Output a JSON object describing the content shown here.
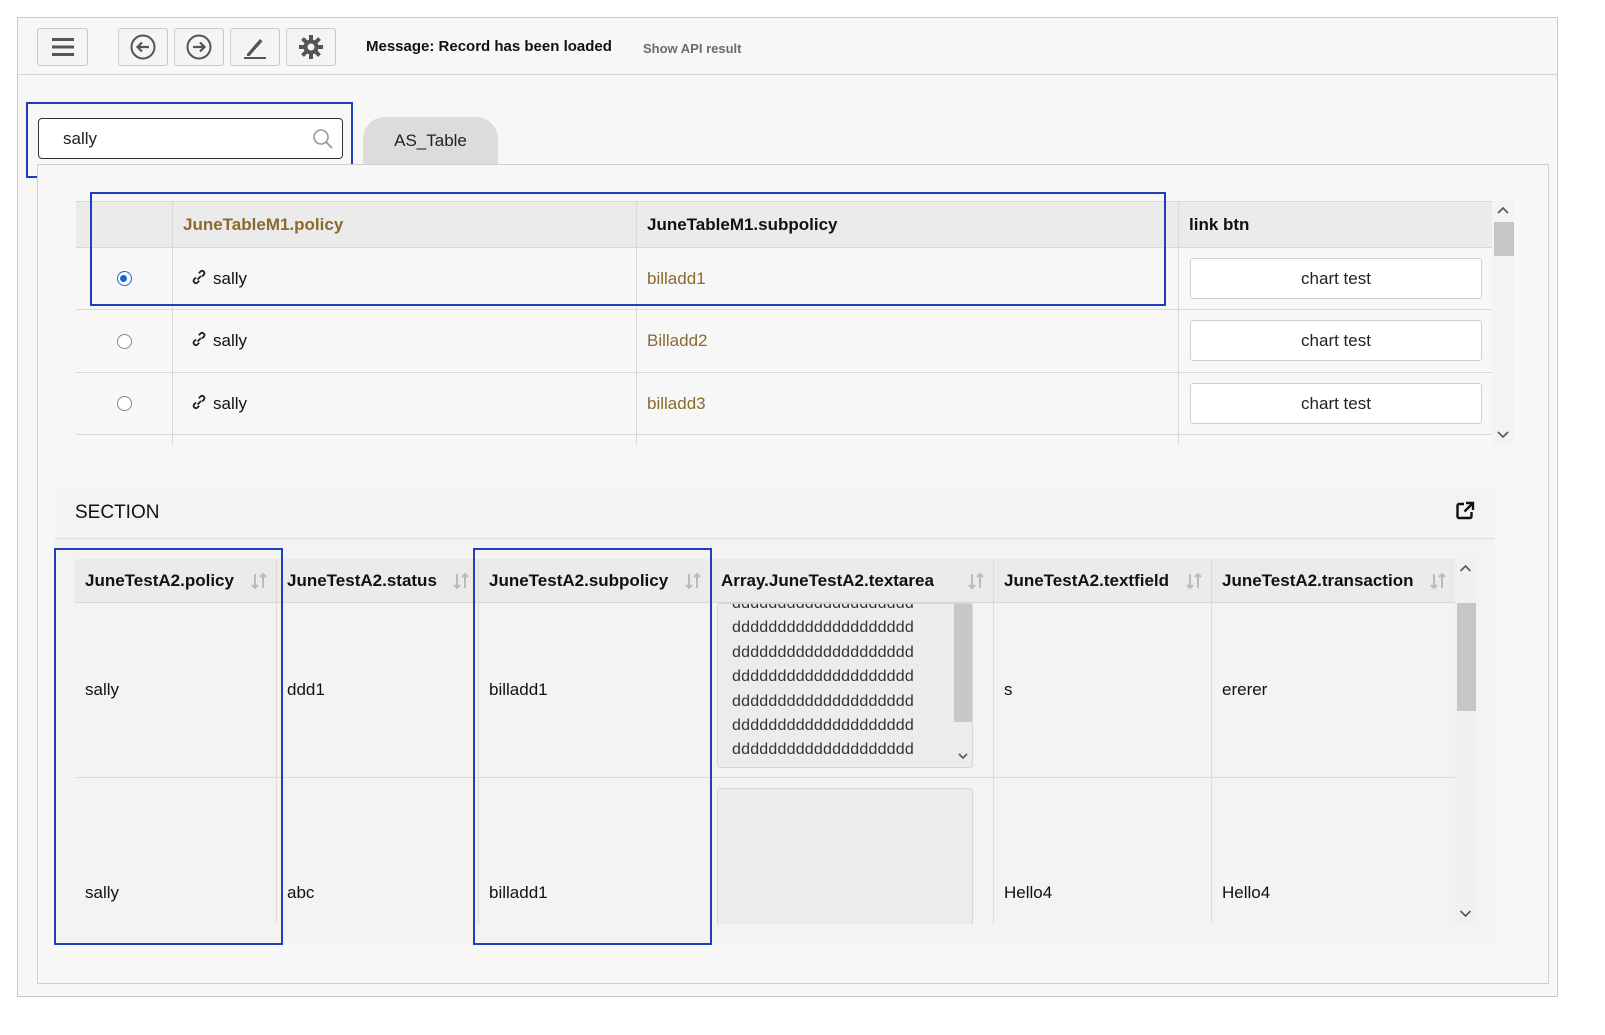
{
  "toolbar": {
    "message": "Message: Record has been loaded",
    "api_link": "Show API result",
    "icons": [
      "menu-icon",
      "back-arrow-icon",
      "forward-arrow-icon",
      "edit-pen-icon",
      "gear-icon"
    ]
  },
  "search": {
    "value": "sally",
    "icon": "search-icon"
  },
  "tab": {
    "label": "AS_Table"
  },
  "table1": {
    "headers": [
      "JuneTableM1.policy",
      "JuneTableM1.subpolicy",
      "link btn"
    ],
    "rows": [
      {
        "selected": true,
        "policy": "sally",
        "subpolicy": "billadd1",
        "button": "chart test"
      },
      {
        "selected": false,
        "policy": "sally",
        "subpolicy": "Billadd2",
        "button": "chart test"
      },
      {
        "selected": false,
        "policy": "sally",
        "subpolicy": "billadd3",
        "button": "chart test"
      }
    ]
  },
  "section": {
    "title": "SECTION",
    "popout_icon": "external-link-icon",
    "headers": [
      "JuneTestA2.policy",
      "JuneTestA2.status",
      "JuneTestA2.subpolicy",
      "Array.JuneTestA2.textarea",
      "JuneTestA2.textfield",
      "JuneTestA2.transaction"
    ],
    "rows": [
      {
        "policy": "sally",
        "status": "ddd1",
        "subpolicy": "billadd1",
        "textarea_lines": [
          "dddddddddddddddddddd",
          "dddddddddddddddddddd",
          "dddddddddddddddddddd",
          "dddddddddddddddddddd",
          "dddddddddddddddddddd",
          "dddddddddddddddddddd",
          "dddddddddddddddddddd"
        ],
        "textfield": "s",
        "transaction": "ererer"
      },
      {
        "policy": "sally",
        "status": "abc",
        "subpolicy": "billadd1",
        "textarea_lines": [],
        "textfield": "Hello4",
        "transaction": "Hello4"
      }
    ]
  },
  "colors": {
    "accent": "#1a66d6",
    "highlight": "#1f3fbf",
    "gold": "#8a6a2e"
  }
}
